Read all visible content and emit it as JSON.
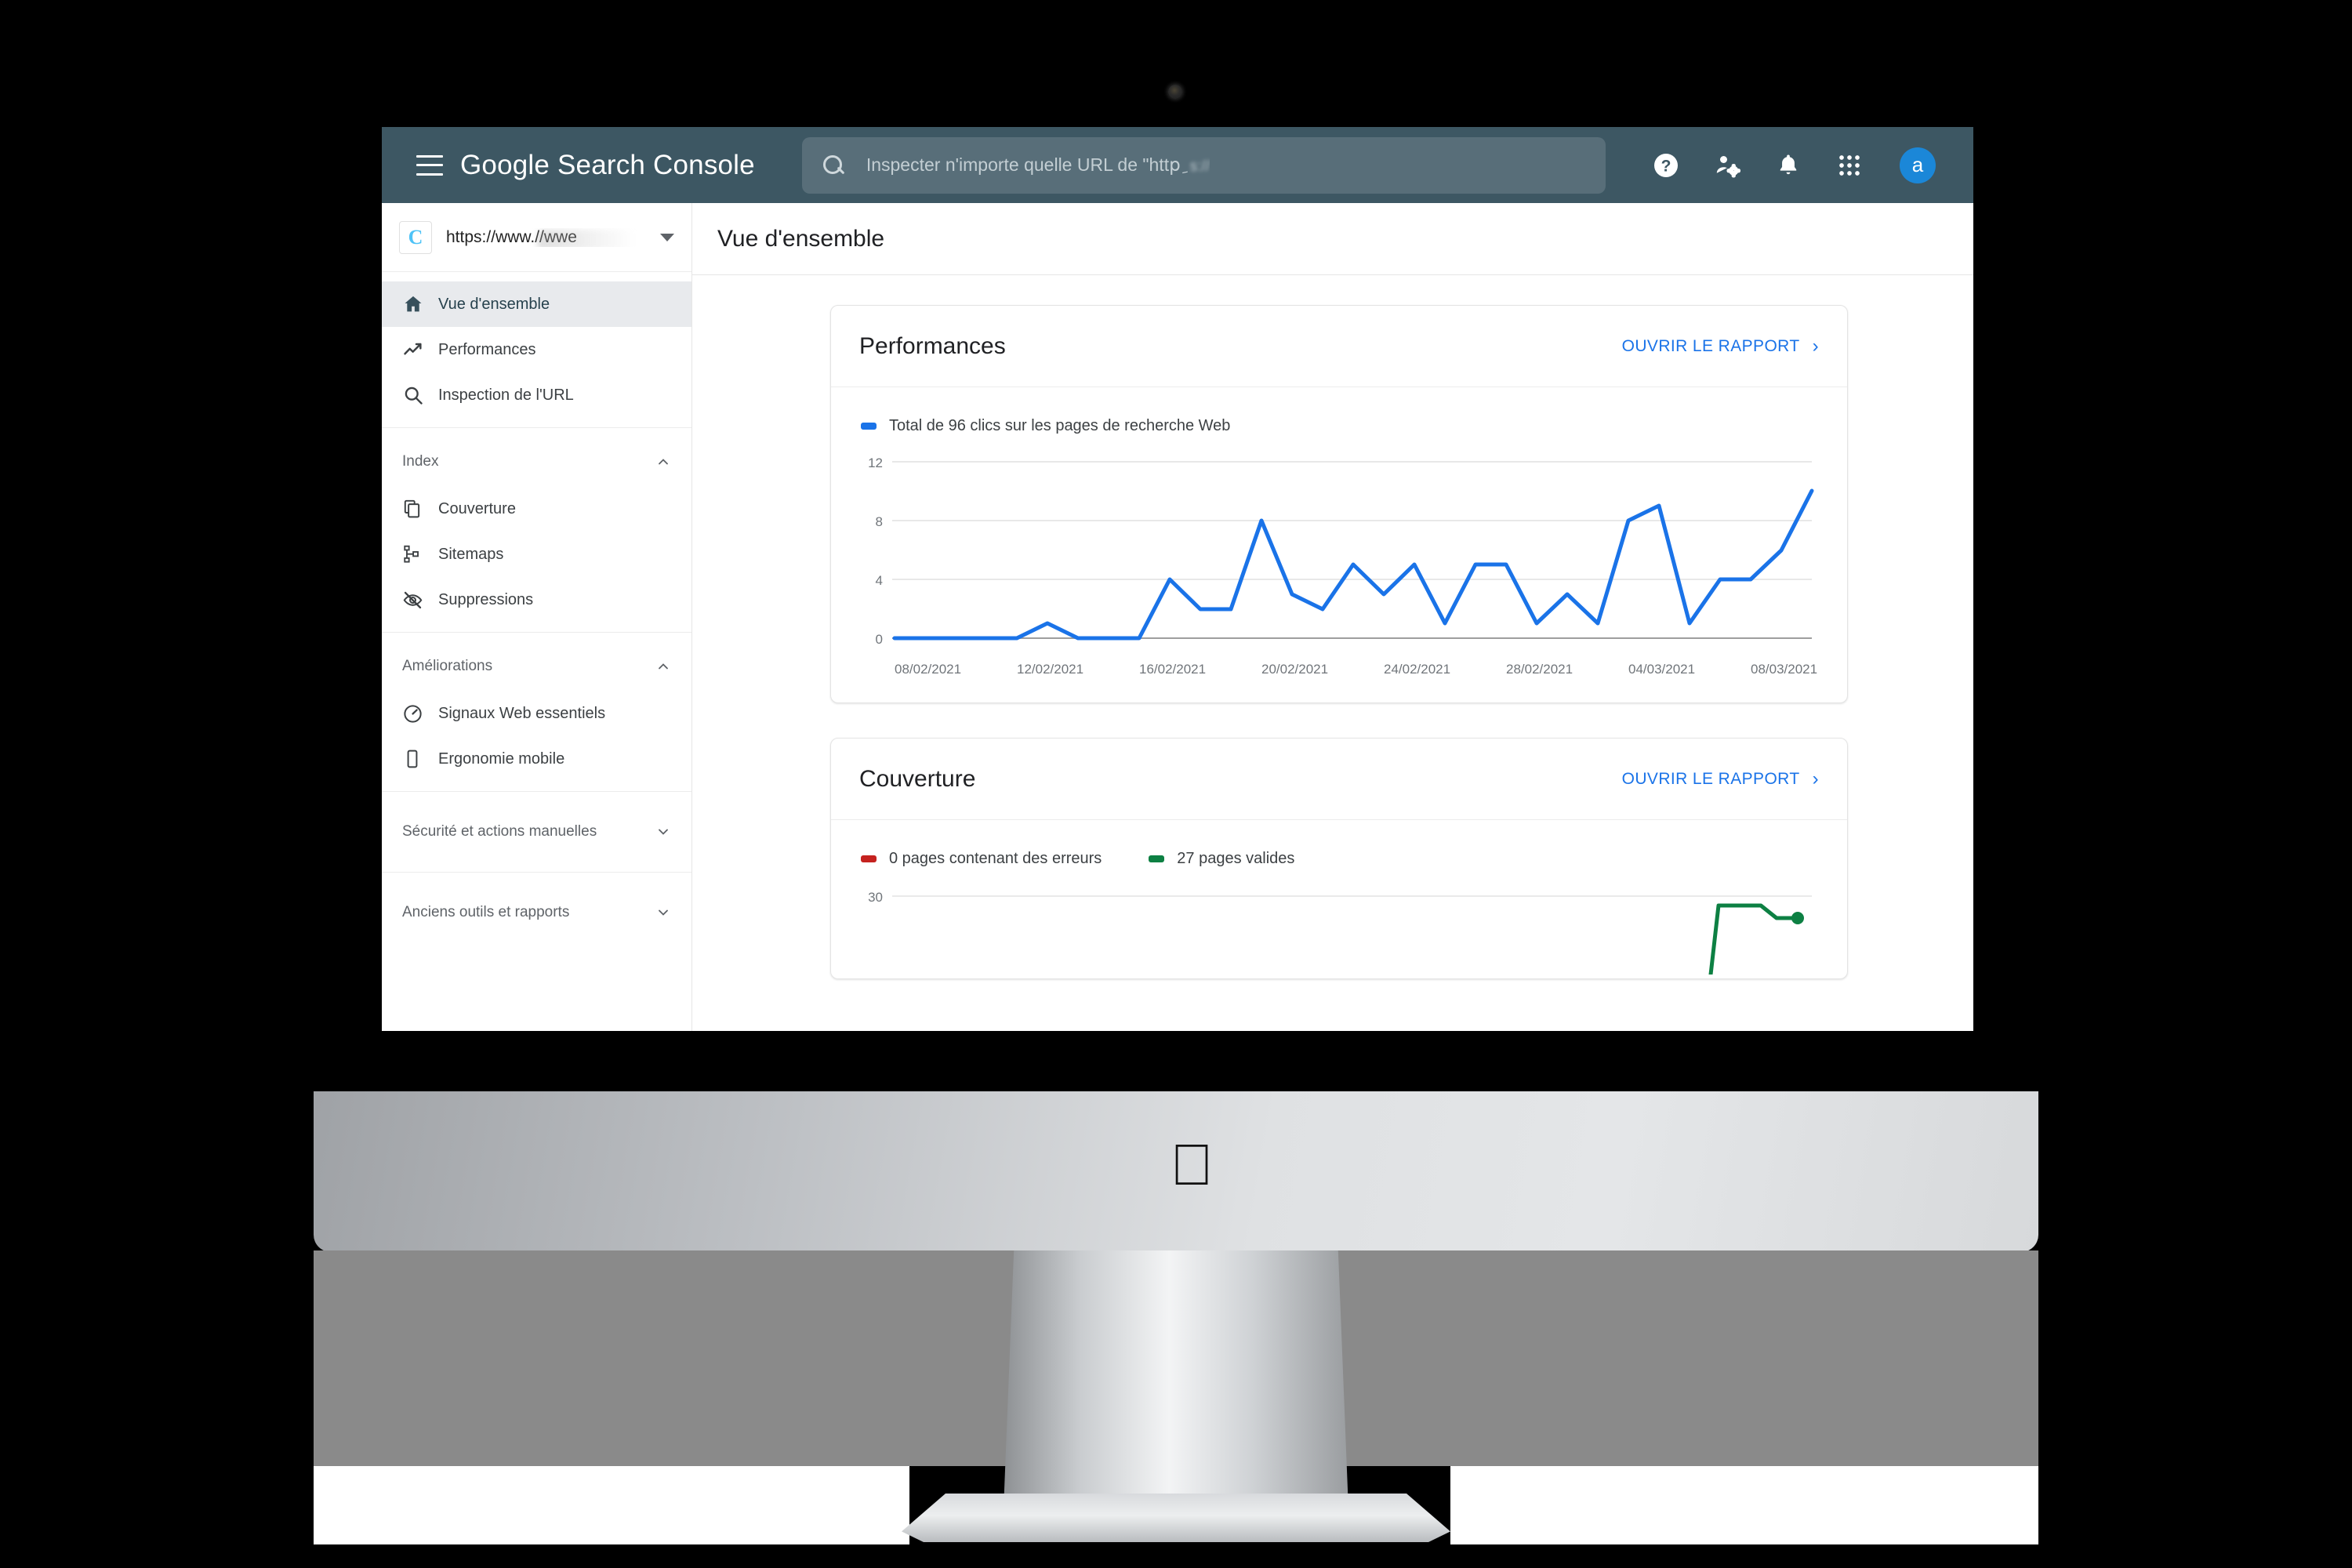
{
  "header": {
    "menu_icon": "hamburger-icon",
    "brand_bold": "Google",
    "brand_light": " Search Console",
    "search_placeholder": "Inspecter n'importe quelle URL de \"httpِ",
    "search_placeholder_blurred": "s://",
    "search_value": "",
    "icons": [
      "help-icon",
      "account-settings-icon",
      "notifications-bell-icon",
      "apps-grid-icon"
    ],
    "avatar_initial": "a",
    "bg_color": "#3d5763",
    "avatar_color": "#1b87d8"
  },
  "property_selector": {
    "logo_letter": "C",
    "url": "https://www.//wwe",
    "caret": "chevron-down-icon"
  },
  "sidebar": {
    "primary": [
      {
        "label": "Vue d'ensemble",
        "icon": "home-icon",
        "active": true
      },
      {
        "label": "Performances",
        "icon": "trending-up-icon",
        "active": false
      },
      {
        "label": "Inspection de l'URL",
        "icon": "search-icon",
        "active": false
      }
    ],
    "sections": [
      {
        "title": "Index",
        "state": "expanded",
        "items": [
          {
            "label": "Couverture",
            "icon": "pages-copy-icon"
          },
          {
            "label": "Sitemaps",
            "icon": "sitemap-icon"
          },
          {
            "label": "Suppressions",
            "icon": "eye-off-icon"
          }
        ]
      },
      {
        "title": "Améliorations",
        "state": "expanded",
        "items": [
          {
            "label": "Signaux Web essentiels",
            "icon": "speedometer-icon"
          },
          {
            "label": "Ergonomie mobile",
            "icon": "mobile-phone-icon"
          }
        ]
      },
      {
        "title": "Sécurité et actions manuelles",
        "state": "collapsed",
        "items": []
      },
      {
        "title": "Anciens outils et rapports",
        "state": "collapsed",
        "items": []
      }
    ]
  },
  "page": {
    "title": "Vue d'ensemble"
  },
  "cards": [
    {
      "title": "Performances",
      "link_label": "OUVRIR LE RAPPORT",
      "link_arrow": "›",
      "legend": [
        {
          "label": "Total de 96 clics sur les pages de recherche Web",
          "color": "#1a73e8"
        }
      ]
    },
    {
      "title": "Couverture",
      "link_label": "OUVRIR LE RAPPORT",
      "link_arrow": "›",
      "legend": [
        {
          "label": "0 pages contenant des erreurs",
          "color": "#c5221f"
        },
        {
          "label": "27 pages valides",
          "color": "#0d8043"
        }
      ]
    }
  ],
  "chart_data": [
    {
      "type": "line",
      "title": "Performances",
      "series_name": "Total de 96 clics sur les pages de recherche Web",
      "color": "#1a73e8",
      "xlabel": "",
      "ylabel": "",
      "ylim": [
        0,
        12
      ],
      "yticks": [
        0,
        4,
        8,
        12
      ],
      "grid": true,
      "legend_position": "top-left",
      "x": [
        "08/02/2021",
        "09/02/2021",
        "10/02/2021",
        "11/02/2021",
        "12/02/2021",
        "13/02/2021",
        "14/02/2021",
        "15/02/2021",
        "16/02/2021",
        "17/02/2021",
        "18/02/2021",
        "19/02/2021",
        "20/02/2021",
        "21/02/2021",
        "22/02/2021",
        "23/02/2021",
        "24/02/2021",
        "25/02/2021",
        "26/02/2021",
        "27/02/2021",
        "28/02/2021",
        "01/03/2021",
        "02/03/2021",
        "03/03/2021",
        "04/03/2021",
        "05/03/2021",
        "06/03/2021",
        "07/03/2021",
        "08/03/2021",
        "09/03/2021"
      ],
      "xticks": [
        "08/02/2021",
        "12/02/2021",
        "16/02/2021",
        "20/02/2021",
        "24/02/2021",
        "28/02/2021",
        "04/03/2021",
        "08/03/2021"
      ],
      "values": [
        0,
        0,
        0,
        0,
        0,
        1,
        0,
        0,
        0,
        4,
        2,
        2,
        8,
        3,
        2,
        5,
        3,
        5,
        1,
        5,
        5,
        1,
        3,
        1,
        8,
        9,
        1,
        4,
        4,
        6,
        10
      ]
    },
    {
      "type": "line",
      "title": "Couverture",
      "ylim": [
        0,
        30
      ],
      "yticks": [
        30
      ],
      "grid": true,
      "legend_position": "top-left",
      "series": [
        {
          "name": "0 pages contenant des erreurs",
          "color": "#c5221f",
          "values": [
            0,
            0,
            0,
            0,
            0,
            0,
            0,
            0,
            0,
            0
          ]
        },
        {
          "name": "27 pages valides",
          "color": "#0d8043",
          "values": [
            0,
            0,
            0,
            0,
            0,
            0,
            0,
            0,
            28,
            27
          ]
        }
      ]
    }
  ],
  "device": {
    "brand_logo": "apple-logo",
    "webcam": "webcam-dot"
  }
}
